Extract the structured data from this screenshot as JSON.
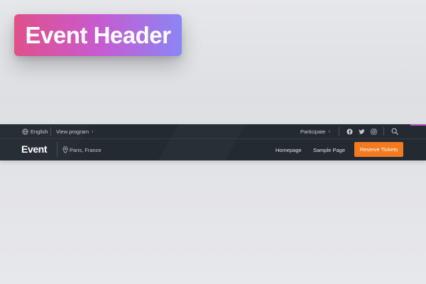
{
  "badge": {
    "title": "Event Header",
    "gradient": [
      "#e0508a",
      "#c85ad0",
      "#8c85f5"
    ]
  },
  "header": {
    "top_bar": {
      "language": {
        "label": "English",
        "icon": "globe-icon"
      },
      "program": {
        "label": "View program",
        "icon": "chevron-right-icon"
      },
      "participate": {
        "label": "Participate",
        "icon": "chevron-right-icon"
      },
      "social": [
        {
          "name": "facebook",
          "icon": "facebook-icon"
        },
        {
          "name": "twitter",
          "icon": "twitter-icon"
        },
        {
          "name": "instagram",
          "icon": "instagram-icon"
        }
      ],
      "search_icon": "search-icon"
    },
    "main_bar": {
      "logo": "Event",
      "location": {
        "label": "Paris, France",
        "icon": "map-pin-icon"
      },
      "nav": [
        {
          "label": "Homepage"
        },
        {
          "label": "Sample Page"
        }
      ],
      "cta": {
        "label": "Reserve Tickets",
        "color": "#f47a1f"
      }
    },
    "colors": {
      "background": "#242a31",
      "text_muted": "#c8ccd2",
      "text": "#e4e6ea",
      "accent": "#b84ac8"
    }
  }
}
